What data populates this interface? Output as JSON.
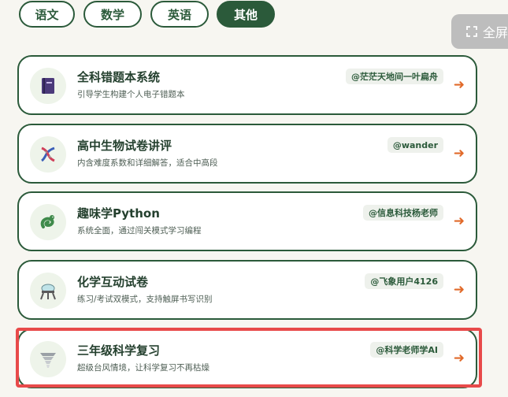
{
  "tabs": [
    {
      "label": "语文",
      "active": false
    },
    {
      "label": "数学",
      "active": false
    },
    {
      "label": "英语",
      "active": false
    },
    {
      "label": "其他",
      "active": true
    }
  ],
  "fullscreen": {
    "label": "全屏",
    "icon": "expand-icon"
  },
  "cards": [
    {
      "title": "全科错题本系统",
      "desc": "引导学生构建个人电子错题本",
      "author": "@茫茫天地间一叶扁舟",
      "icon": "notebook-icon",
      "arrow": "➜"
    },
    {
      "title": "高中生物试卷讲评",
      "desc": "内含难度系数和详细解答，适合中高段",
      "author": "@wander",
      "icon": "dna-icon",
      "arrow": "➜"
    },
    {
      "title": "趣味学Python",
      "desc": "系统全面，通过闯关模式学习编程",
      "author": "@信息科技杨老师",
      "icon": "snake-icon",
      "arrow": "➜"
    },
    {
      "title": "化学互动试卷",
      "desc": "练习/考试双模式，支持触屏书写识别",
      "author": "@飞象用户4126",
      "icon": "flask-icon",
      "arrow": "➜"
    },
    {
      "title": "三年级科学复习",
      "desc": "超级台风情境，让科学复习不再枯燥",
      "author": "@科学老师学AI",
      "icon": "tornado-icon",
      "arrow": "➜"
    }
  ],
  "colors": {
    "primary": "#2b5a3a",
    "accent": "#e16a2a",
    "highlight": "#e84a4a"
  }
}
